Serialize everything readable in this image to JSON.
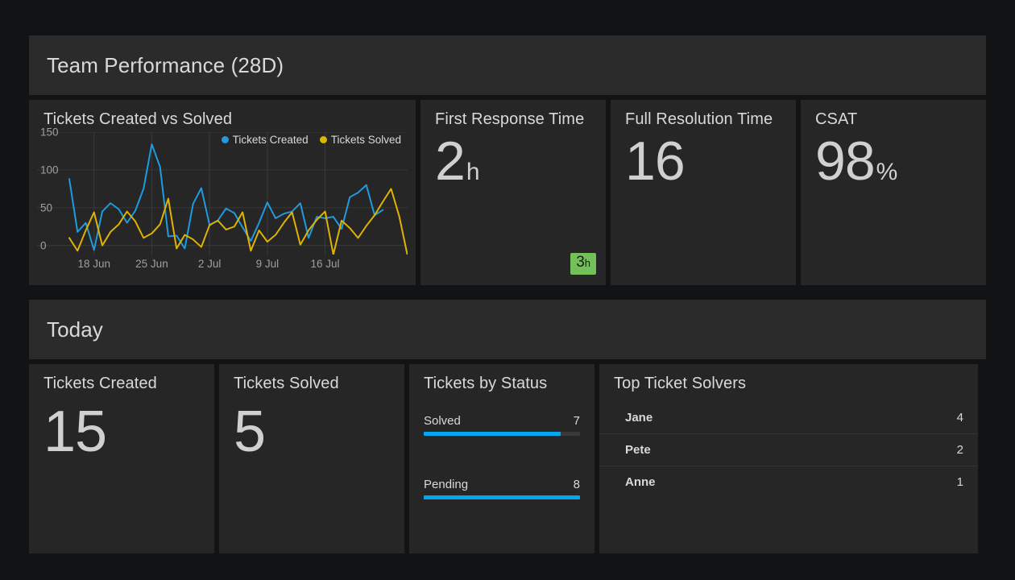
{
  "rows": [
    {
      "title": "Team Performance (28D)"
    },
    {
      "title": "Today"
    }
  ],
  "colors": {
    "created": "#1f9bde",
    "solved": "#e0b400",
    "bar": "#00a8f0",
    "badge_green": "#73bf5a",
    "panel_bg": "#262626",
    "page_bg": "#111314"
  },
  "graph_panel": {
    "title": "Tickets Created vs Solved"
  },
  "stats": [
    {
      "title": "First Response Time",
      "value": "2",
      "unit": "h",
      "badge": "3",
      "badge_unit": "h"
    },
    {
      "title": "Full Resolution Time",
      "value": "16",
      "unit": ""
    },
    {
      "title": "CSAT",
      "value": "98",
      "unit": "%"
    }
  ],
  "today_stats": [
    {
      "title": "Tickets Created",
      "value": "15",
      "unit": ""
    },
    {
      "title": "Tickets Solved",
      "value": "5",
      "unit": ""
    }
  ],
  "status_panel": {
    "title": "Tickets by Status",
    "items": [
      {
        "label": "Solved",
        "value": "7",
        "pct": 87.5
      },
      {
        "label": "Pending",
        "value": "8",
        "pct": 100
      }
    ]
  },
  "solvers_panel": {
    "title": "Top Ticket Solvers",
    "rows": [
      {
        "name": "Jane",
        "count": "4"
      },
      {
        "name": "Pete",
        "count": "2"
      },
      {
        "name": "Anne",
        "count": "1"
      }
    ]
  },
  "chart_data": {
    "type": "line",
    "title": "Tickets Created vs Solved",
    "xlabel": "",
    "ylabel": "",
    "ylim": [
      -12,
      150
    ],
    "yticks": [
      0,
      50,
      100,
      150
    ],
    "grid": true,
    "legend_position": "top-right",
    "xtick_labels": [
      "18 Jun",
      "25 Jun",
      "2 Jul",
      "9 Jul",
      "16 Jul"
    ],
    "xtick_indices": [
      3,
      10,
      17,
      24,
      31
    ],
    "x": [
      0,
      1,
      2,
      3,
      4,
      5,
      6,
      7,
      8,
      9,
      10,
      11,
      12,
      13,
      14,
      15,
      16,
      17,
      18,
      19,
      20,
      21,
      22,
      23,
      24,
      25,
      26,
      27,
      28,
      29,
      30,
      31,
      32,
      33,
      34
    ],
    "series": [
      {
        "name": "Tickets Created",
        "color": "#1f9bde",
        "values": [
          88,
          18,
          30,
          -6,
          45,
          56,
          48,
          30,
          46,
          75,
          134,
          104,
          12,
          13,
          -4,
          55,
          76,
          27,
          33,
          49,
          43,
          24,
          6,
          30,
          57,
          36,
          42,
          45,
          56,
          10,
          38,
          36,
          38,
          22,
          64,
          70,
          80,
          40,
          47
        ]
      },
      {
        "name": "Tickets Solved",
        "color": "#e0b400",
        "values": [
          10,
          -7,
          20,
          44,
          0,
          18,
          28,
          45,
          32,
          10,
          16,
          28,
          62,
          -4,
          14,
          8,
          -2,
          27,
          33,
          21,
          25,
          44,
          -7,
          20,
          5,
          14,
          30,
          44,
          1,
          20,
          34,
          45,
          -12,
          33,
          23,
          10,
          26,
          40,
          58,
          75,
          38,
          -14
        ]
      }
    ]
  }
}
